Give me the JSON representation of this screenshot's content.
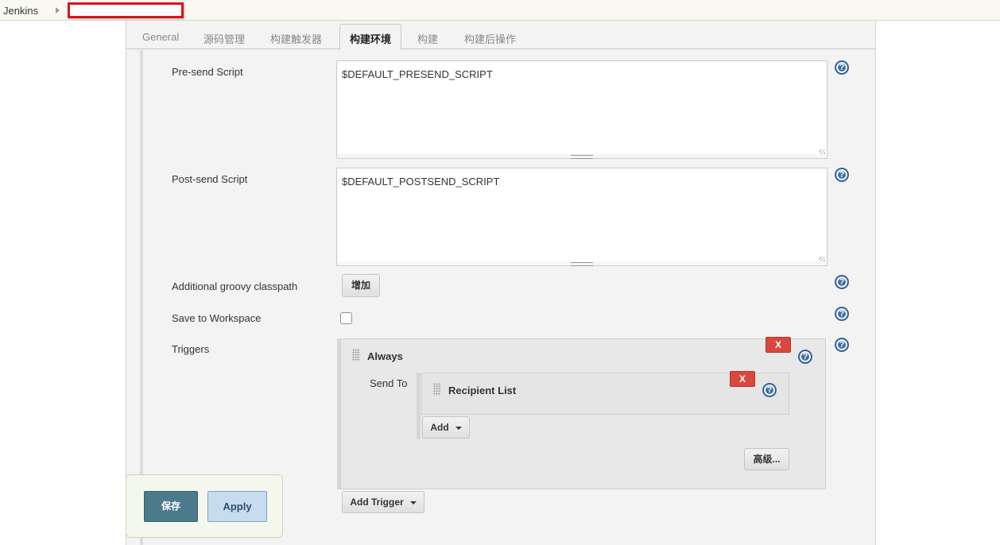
{
  "breadcrumb": {
    "root": "Jenkins",
    "separator_icon": "triangle-right-icon"
  },
  "tabs": [
    {
      "label": "General",
      "active": false
    },
    {
      "label": "源码管理",
      "active": false
    },
    {
      "label": "构建触发器",
      "active": false
    },
    {
      "label": "构建环境",
      "active": true
    },
    {
      "label": "构建",
      "active": false
    },
    {
      "label": "构建后操作",
      "active": false
    }
  ],
  "form": {
    "presend": {
      "label": "Pre-send Script",
      "value": "$DEFAULT_PRESEND_SCRIPT"
    },
    "postsend": {
      "label": "Post-send Script",
      "value": "$DEFAULT_POSTSEND_SCRIPT"
    },
    "groovy": {
      "label": "Additional groovy classpath",
      "button": "增加"
    },
    "workspace": {
      "label": "Save to Workspace",
      "checked": false
    },
    "triggers": {
      "label": "Triggers",
      "trigger_name": "Always",
      "delete_label": "X",
      "send_to_label": "Send To",
      "recipient_name": "Recipient List",
      "add_label": "Add",
      "advanced_label": "高级...",
      "add_trigger_label": "Add Trigger"
    }
  },
  "help_icon_text": "?",
  "footer": {
    "save_label": "保存",
    "apply_label": "Apply"
  },
  "colors": {
    "save": "#4a7a8c",
    "apply": "#c7dcef",
    "delete": "#d9473d",
    "help": "#3b6fa8"
  }
}
